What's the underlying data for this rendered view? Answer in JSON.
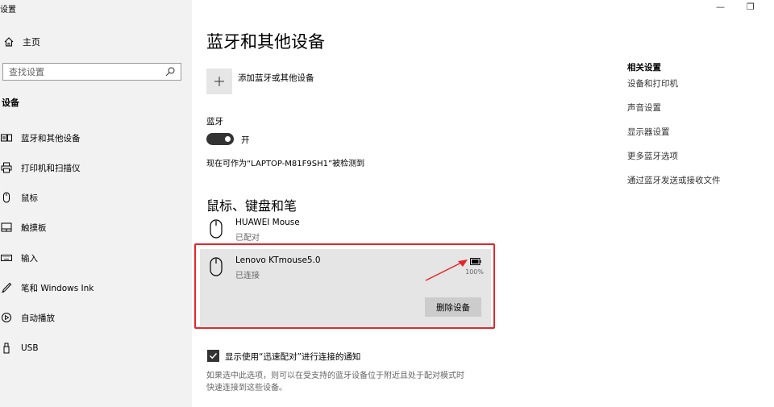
{
  "window": {
    "title": "设置",
    "minimize": "—",
    "restore": "❐"
  },
  "sidebar": {
    "home": "主页",
    "search_placeholder": "查找设置",
    "section": "设备",
    "items": [
      {
        "label": "蓝牙和其他设备",
        "icon": "bluetooth-devices-icon"
      },
      {
        "label": "打印机和扫描仪",
        "icon": "printer-icon"
      },
      {
        "label": "鼠标",
        "icon": "mouse-icon"
      },
      {
        "label": "触摸板",
        "icon": "touchpad-icon"
      },
      {
        "label": "输入",
        "icon": "keyboard-icon"
      },
      {
        "label": "笔和 Windows Ink",
        "icon": "pen-icon"
      },
      {
        "label": "自动播放",
        "icon": "autoplay-icon"
      },
      {
        "label": "USB",
        "icon": "usb-icon"
      }
    ]
  },
  "main": {
    "title": "蓝牙和其他设备",
    "add_device": "添加蓝牙或其他设备",
    "bluetooth_label": "蓝牙",
    "bluetooth_state": "开",
    "discoverable": "现在可作为“LAPTOP-M81F9SH1”被检测到",
    "section_title": "鼠标、键盘和笔",
    "devices": [
      {
        "name": "HUAWEI  Mouse",
        "status": "已配对"
      },
      {
        "name": "Lenovo KTmouse5.0",
        "status": "已连接",
        "battery": "100%",
        "battery_level": 1.0
      }
    ],
    "remove_button": "删除设备",
    "swift_pair_label": "显示使用“迅速配对”进行连接的通知",
    "swift_pair_checked": true,
    "swift_pair_hint_1": "如果选中此选项，则可以在受支持的蓝牙设备位于附近且处于配对模式时",
    "swift_pair_hint_2": "快速连接到这些设备。"
  },
  "related": {
    "title": "相关设置",
    "links": [
      "设备和打印机",
      "声音设置",
      "显示器设置",
      "更多蓝牙选项",
      "通过蓝牙发送或接收文件"
    ]
  },
  "colors": {
    "annotation": "#e4262a",
    "toggle_on": "#333333",
    "selected_panel": "#e5e5e5"
  }
}
